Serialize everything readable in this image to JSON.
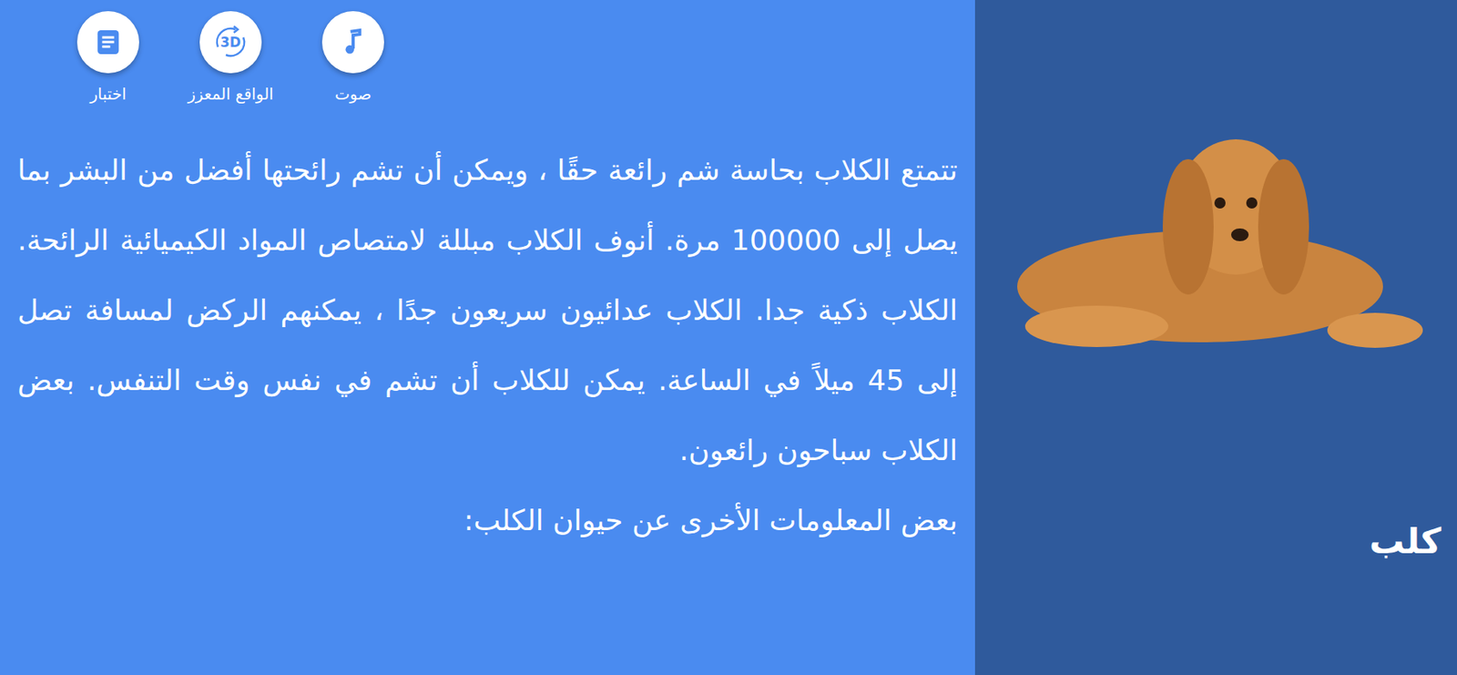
{
  "toolbar": [
    {
      "label": "صوت",
      "kind": "audio"
    },
    {
      "label": "الواقع المعزز",
      "kind": "ar",
      "icon_text": "3D"
    },
    {
      "label": "اختبار",
      "kind": "quiz"
    }
  ],
  "content": {
    "paragraphs": [
      "تتمتع الكلاب بحاسة شم رائعة حقًا ، ويمكن أن تشم رائحتها أفضل من البشر بما يصل إلى 100000 مرة. أنوف الكلاب مبللة لامتصاص المواد الكيميائية الرائحة. الكلاب ذكية جدا. الكلاب عدائيون سريعون جدًا ، يمكنهم الركض لمسافة تصل إلى 45 ميلاً في الساعة. يمكن للكلاب أن تشم في نفس وقت التنفس. بعض الكلاب سباحون رائعون.",
      "بعض المعلومات الأخرى عن حيوان الكلب:"
    ]
  },
  "animal": {
    "name": "كلب"
  }
}
